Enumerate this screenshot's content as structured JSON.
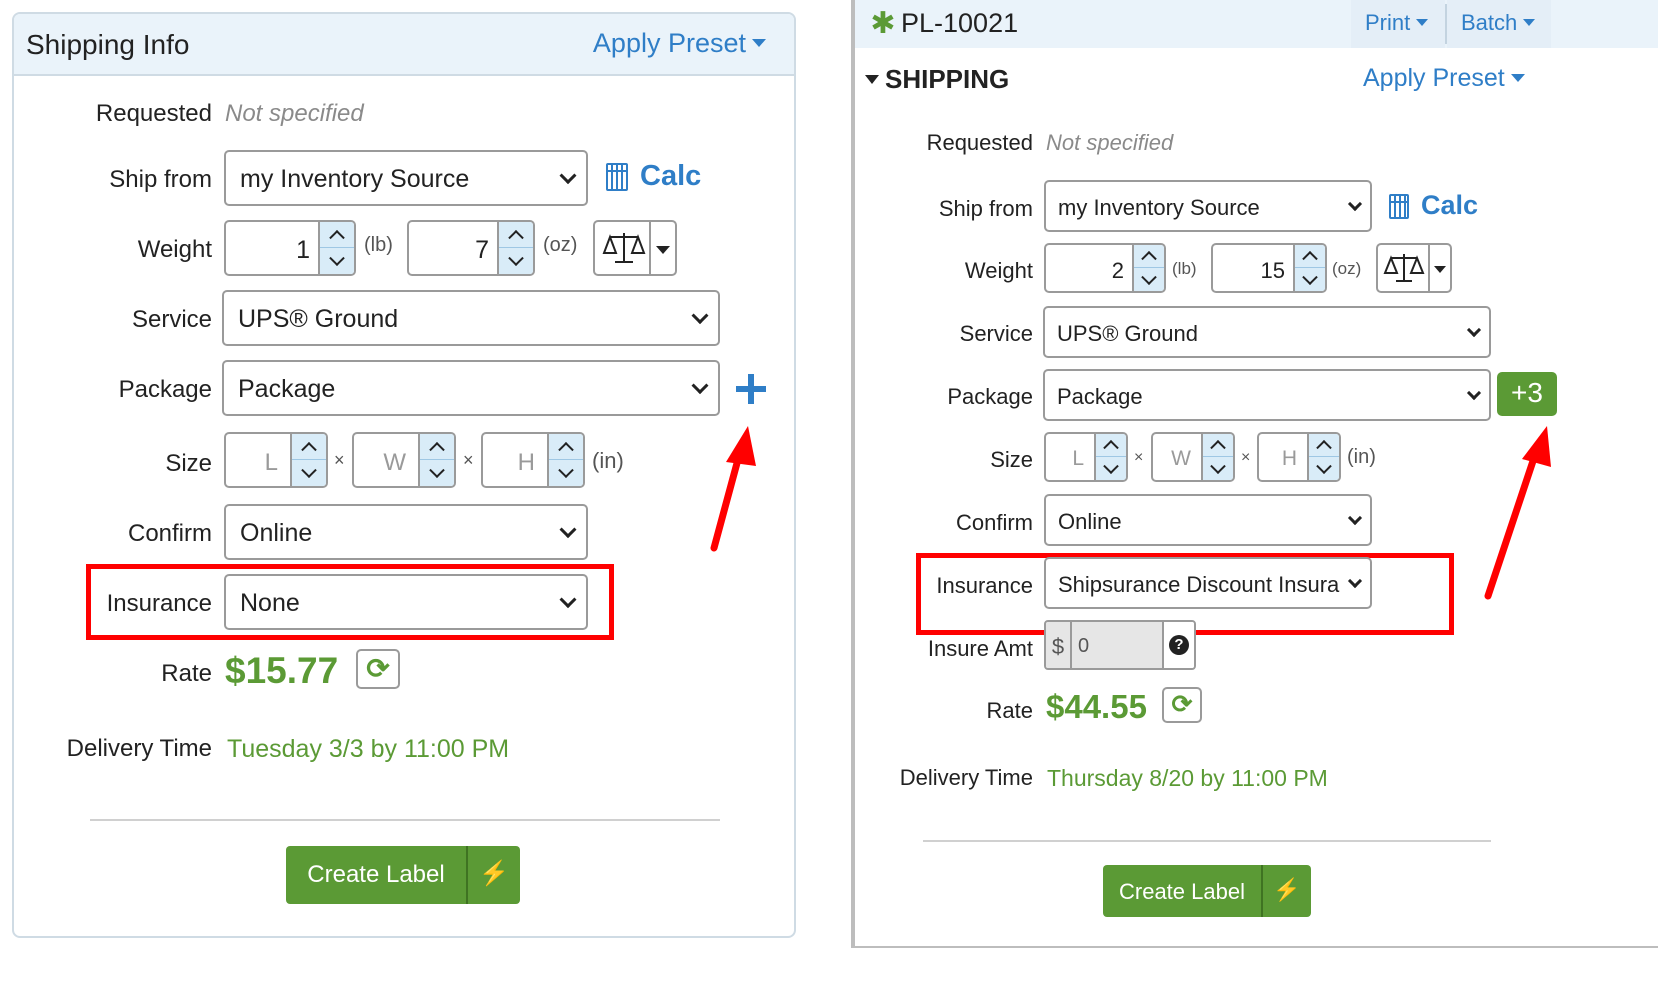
{
  "left": {
    "title": "Shipping Info",
    "apply_preset": "Apply Preset",
    "requested_label": "Requested",
    "requested_value": "Not specified",
    "ship_from_label": "Ship from",
    "ship_from_value": "my Inventory Source",
    "calc_label": "Calc",
    "weight_label": "Weight",
    "weight_lb": "1",
    "weight_lb_unit": "(lb)",
    "weight_oz": "7",
    "weight_oz_unit": "(oz)",
    "service_label": "Service",
    "service_value": "UPS® Ground",
    "package_label": "Package",
    "package_value": "Package",
    "size_label": "Size",
    "size_l_placeholder": "L",
    "size_w_placeholder": "W",
    "size_h_placeholder": "H",
    "size_sep": "×",
    "size_unit": "(in)",
    "confirm_label": "Confirm",
    "confirm_value": "Online",
    "insurance_label": "Insurance",
    "insurance_value": "None",
    "rate_label": "Rate",
    "rate_value": "$15.77",
    "delivery_label": "Delivery Time",
    "delivery_value": "Tuesday 3/3 by 11:00 PM",
    "create_label": "Create Label"
  },
  "right": {
    "order_id": "PL-10021",
    "print_label": "Print",
    "batch_label": "Batch",
    "section_title": "SHIPPING",
    "apply_preset": "Apply Preset",
    "requested_label": "Requested",
    "requested_value": "Not specified",
    "ship_from_label": "Ship from",
    "ship_from_value": "my Inventory Source",
    "calc_label": "Calc",
    "weight_label": "Weight",
    "weight_lb": "2",
    "weight_lb_unit": "(lb)",
    "weight_oz": "15",
    "weight_oz_unit": "(oz)",
    "service_label": "Service",
    "service_value": "UPS® Ground",
    "package_label": "Package",
    "package_value": "Package",
    "extra_packages": "+3",
    "size_label": "Size",
    "size_l_placeholder": "L",
    "size_w_placeholder": "W",
    "size_h_placeholder": "H",
    "size_sep": "×",
    "size_unit": "(in)",
    "confirm_label": "Confirm",
    "confirm_value": "Online",
    "insurance_label": "Insurance",
    "insurance_value": "Shipsurance Discount Insura",
    "insure_amt_label": "Insure Amt",
    "insure_amt_currency": "$",
    "insure_amt_value": "0",
    "rate_label": "Rate",
    "rate_value": "$44.55",
    "delivery_label": "Delivery Time",
    "delivery_value": "Thursday 8/20 by 11:00 PM",
    "create_label": "Create Label"
  },
  "colors": {
    "link_blue": "#2f7ec7",
    "action_green": "#5b9a35",
    "annotation_red": "#ff0000"
  }
}
